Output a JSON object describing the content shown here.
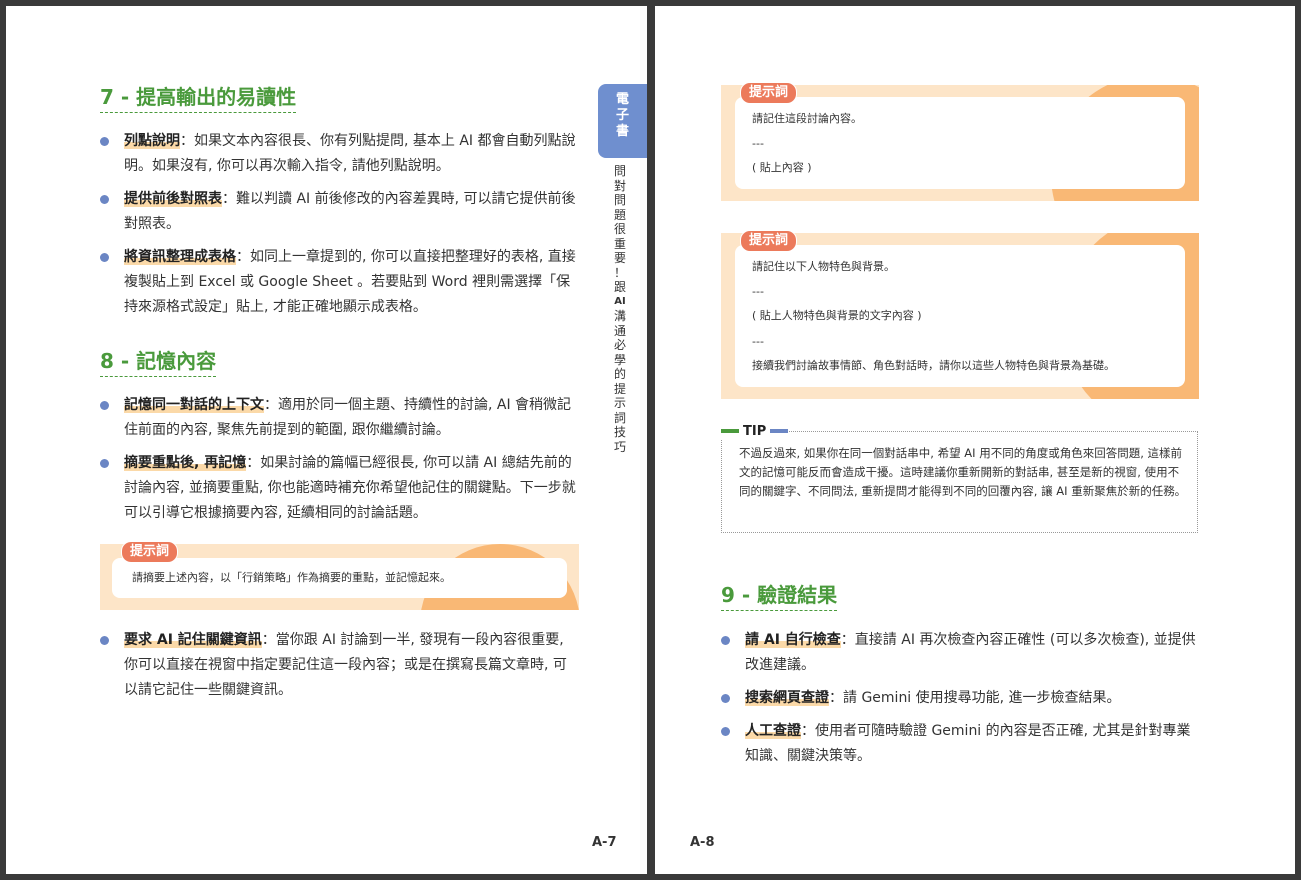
{
  "left_page": {
    "section7": {
      "title": "7 - 提高輸出的易讀性",
      "items": [
        {
          "key": "列點說明",
          "text": "：如果文本內容很長、你有列點提問, 基本上 AI 都會自動列點說明。如果沒有, 你可以再次輸入指令, 請他列點說明。"
        },
        {
          "key": "提供前後對照表",
          "text": "：難以判讀 AI 前後修改的內容差異時, 可以請它提供前後對照表。"
        },
        {
          "key": "將資訊整理成表格",
          "text": "：如同上一章提到的, 你可以直接把整理好的表格, 直接複製貼上到 Excel 或 Google Sheet 。若要貼到 Word 裡則需選擇「保持來源格式設定」貼上, 才能正確地顯示成表格。"
        }
      ]
    },
    "section8": {
      "title": "8 - 記憶內容",
      "items": [
        {
          "key": "記憶同一對話的上下文",
          "text": "：適用於同一個主題、持續性的討論, AI 會稍微記住前面的內容, 聚焦先前提到的範圍, 跟你繼續討論。"
        },
        {
          "key": "摘要重點後, 再記憶",
          "text": "：如果討論的篇幅已經很長, 你可以請 AI 總結先前的討論內容, 並摘要重點, 你也能適時補充你希望他記住的關鍵點。下一步就可以引導它根據摘要內容, 延續相同的討論話題。"
        }
      ],
      "prompt": {
        "label": "提示詞",
        "lines": [
          "請摘要上述內容，以「行銷策略」作為摘要的重點，並記憶起來。"
        ]
      },
      "items_after": [
        {
          "key": "要求 AI 記住關鍵資訊",
          "text": "：當你跟 AI 討論到一半, 發現有一段內容很重要, 你可以直接在視窗中指定要記住這一段內容；或是在撰寫長篇文章時, 可以請它記住一些關鍵資訊。"
        }
      ]
    },
    "side_tab": {
      "chars": [
        "電",
        "子",
        "書"
      ]
    },
    "side_text": {
      "chars": [
        "問",
        "對",
        "問",
        "題",
        "很",
        "重",
        "要",
        "！",
        "跟",
        "AI",
        "溝",
        "通",
        "必",
        "學",
        "的",
        "提",
        "示",
        "詞",
        "技",
        "巧"
      ]
    },
    "page_number": "A-7"
  },
  "right_page": {
    "prompt1": {
      "label": "提示詞",
      "lines": [
        "請記住這段討論內容。",
        "---",
        "( 貼上內容 )"
      ]
    },
    "prompt2": {
      "label": "提示詞",
      "lines": [
        "請記住以下人物特色與背景。",
        "---",
        "( 貼上人物特色與背景的文字內容 )",
        "---",
        "接續我們討論故事情節、角色對話時，請你以這些人物特色與背景為基礎。"
      ]
    },
    "tip": {
      "label": "TIP",
      "text": "不過反過來, 如果你在同一個對話串中, 希望 AI 用不同的角度或角色來回答問題, 這樣前文的記憶可能反而會造成干擾。這時建議你重新開新的對話串, 甚至是新的視窗, 使用不同的關鍵字、不同問法, 重新提問才能得到不同的回覆內容, 讓 AI 重新聚焦於新的任務。"
    },
    "section9": {
      "title": "9 - 驗證結果",
      "items": [
        {
          "key": "請 AI 自行檢查",
          "text": "：直接請 AI 再次檢查內容正確性 (可以多次檢查), 並提供改進建議。"
        },
        {
          "key": "搜索網頁查證",
          "text": "：請 Gemini 使用搜尋功能, 進一步檢查結果。"
        },
        {
          "key": "人工查證",
          "text": "：使用者可隨時驗證 Gemini 的內容是否正確, 尤其是針對專業知識、關鍵決策等。"
        }
      ]
    },
    "page_number": "A-8"
  },
  "colors": {
    "heading_green": "#4a9a3c",
    "bullet_blue": "#6b86c4",
    "highlight_orange": "#fbd9a8",
    "prompt_label": "#ec7a5b",
    "prompt_bg": "#fde5c8"
  }
}
